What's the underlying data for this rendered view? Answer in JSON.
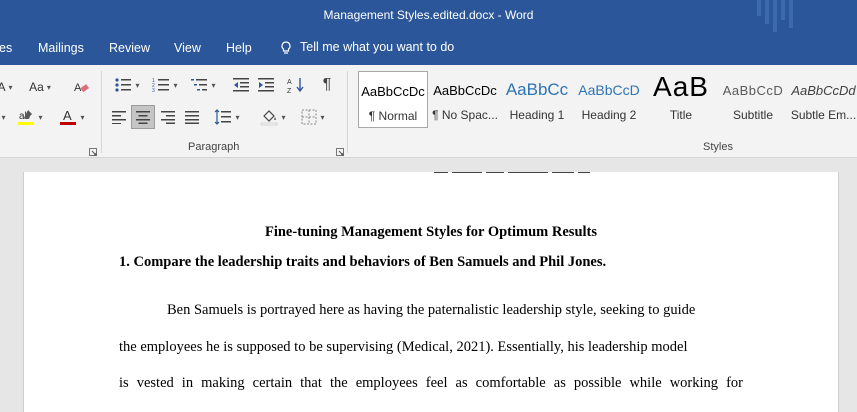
{
  "window": {
    "title": "Management Styles.edited.docx  -  Word"
  },
  "menu": {
    "tabs": [
      "es",
      "Mailings",
      "Review",
      "View",
      "Help"
    ],
    "tell_me": "Tell me what you want to do"
  },
  "ribbon": {
    "font_group": {
      "change_case": "Aa"
    },
    "paragraph_group": {
      "label": "Paragraph",
      "selected_alignment": "center"
    },
    "styles_group": {
      "label": "Styles",
      "items": [
        {
          "sample": "AaBbCcDc",
          "name": "¶ Normal",
          "selected": true
        },
        {
          "sample": "AaBbCcDc",
          "name": "¶ No Spac..."
        },
        {
          "sample": "AaBbCc",
          "name": "Heading 1"
        },
        {
          "sample": "AaBbCcD",
          "name": "Heading 2"
        },
        {
          "sample": "AaB",
          "name": "Title"
        },
        {
          "sample": "AaBbCcD",
          "name": "Subtitle"
        },
        {
          "sample": "AaBbCcDd",
          "name": "Subtle Em..."
        }
      ]
    },
    "colors": {
      "highlight": "#ffff00",
      "font_color": "#c00000",
      "accent": "#2b579a",
      "heading_blue": "#2e74b5"
    }
  },
  "document": {
    "title": "Fine-tuning Management Styles for Optimum Results",
    "question": "1. Compare the leadership traits and behaviors of Ben Samuels and Phil Jones.",
    "paragraph_lines": [
      "Ben Samuels is portrayed here as having the paternalistic leadership style, seeking to guide",
      "the employees he is supposed to be supervising (Medical, 2021). Essentially, his leadership model",
      "is vested in making certain that the employees feel as comfortable as possible while working for"
    ]
  }
}
